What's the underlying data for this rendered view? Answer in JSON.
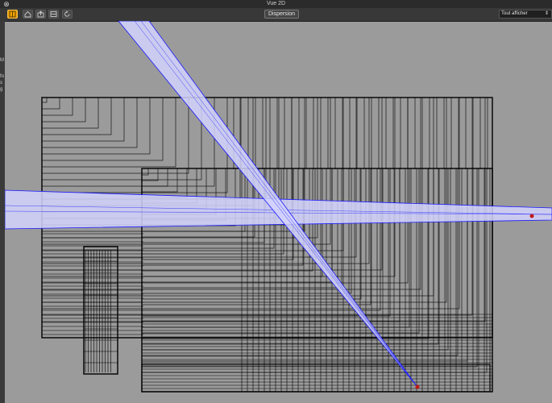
{
  "window": {
    "title": "Vue 2D",
    "close_symbol": "⊗"
  },
  "toolbar": {
    "buttons": [
      {
        "name": "select-tool-icon",
        "active": true
      },
      {
        "name": "home-icon",
        "active": false
      },
      {
        "name": "upload-icon",
        "active": false
      },
      {
        "name": "split-view-icon",
        "active": false
      },
      {
        "name": "rotate-icon",
        "active": false
      }
    ],
    "center_tab": "Dispersion",
    "view_select": {
      "value": "Tout afficher"
    }
  },
  "left_strip": {
    "chars": [
      "M",
      "fo",
      "s",
      "g"
    ]
  },
  "colors": {
    "background": "#9b9b9b",
    "beam_fill": "#d4d4ff",
    "beam_edge": "#1a1aff",
    "wire": "#000000",
    "source_dot": "#c01818",
    "accent_active": "#f0a400"
  }
}
